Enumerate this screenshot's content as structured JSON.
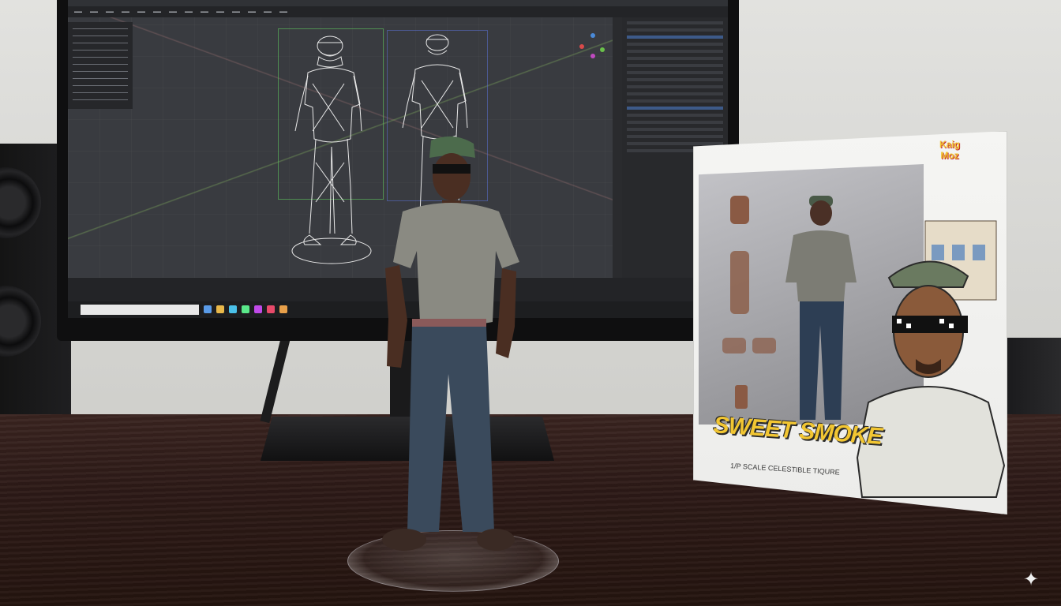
{
  "scene": {
    "box": {
      "title": "SWEET SMOKE",
      "subtitle": "1/P SCALE CELESTIBLE TIQURE",
      "logo_text": "Kaig Moz"
    },
    "colors": {
      "wall": "#dcdcd9",
      "desk": "#2d1a17",
      "figure_cap": "#4c6b4c",
      "figure_shirt": "#8a8a82",
      "figure_jeans": "#3a4a5c",
      "box_title": "#f2c632",
      "wireframe": "#e8e8e8",
      "viewport": "#393b40"
    },
    "icons": {
      "sparkle": "sparkle-icon"
    }
  }
}
